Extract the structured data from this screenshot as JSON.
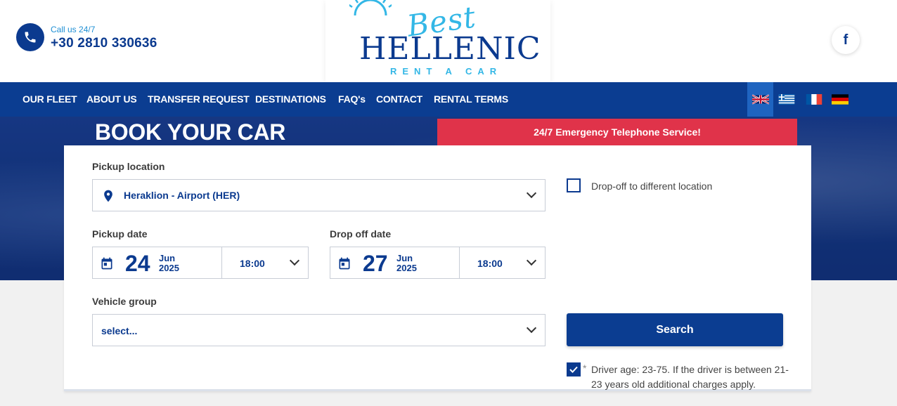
{
  "header": {
    "call_label": "Call us 24/7",
    "phone_number": "+30 2810 330636",
    "logo": {
      "script_text": "Best",
      "main_text": "HELLENIC",
      "sub_text": "RENT A CAR"
    },
    "social_icon": "facebook-icon"
  },
  "nav": {
    "items": [
      "OUR FLEET",
      "ABOUT US",
      "TRANSFER REQUEST",
      "DESTINATIONS",
      "FAQ's",
      "CONTACT",
      "RENTAL TERMS"
    ],
    "languages": [
      "english",
      "greek",
      "french",
      "german"
    ],
    "active_language": "english"
  },
  "hero": {
    "title": "BOOK YOUR CAR",
    "emergency": "24/7 Emergency Telephone Service!"
  },
  "form": {
    "pickup_location": {
      "label": "Pickup location",
      "value": "Heraklion - Airport (HER)"
    },
    "dropoff_different": {
      "label": "Drop-off to different location",
      "checked": false
    },
    "pickup_date": {
      "label": "Pickup date",
      "day": "24",
      "month": "Jun",
      "year": "2025",
      "time": "18:00"
    },
    "dropoff_date": {
      "label": "Drop off date",
      "day": "27",
      "month": "Jun",
      "year": "2025",
      "time": "18:00"
    },
    "vehicle_group": {
      "label": "Vehicle group",
      "value": "select..."
    },
    "search_label": "Search",
    "driver_age": {
      "asterisk": "*",
      "text": "Driver age: 23-75. If the driver is between 21-23 years old additional charges apply.",
      "checked": true
    }
  },
  "colors": {
    "brand_blue": "#0b3d91",
    "accent_light_blue": "#33b7e6",
    "emergency_red": "#e0334a"
  }
}
